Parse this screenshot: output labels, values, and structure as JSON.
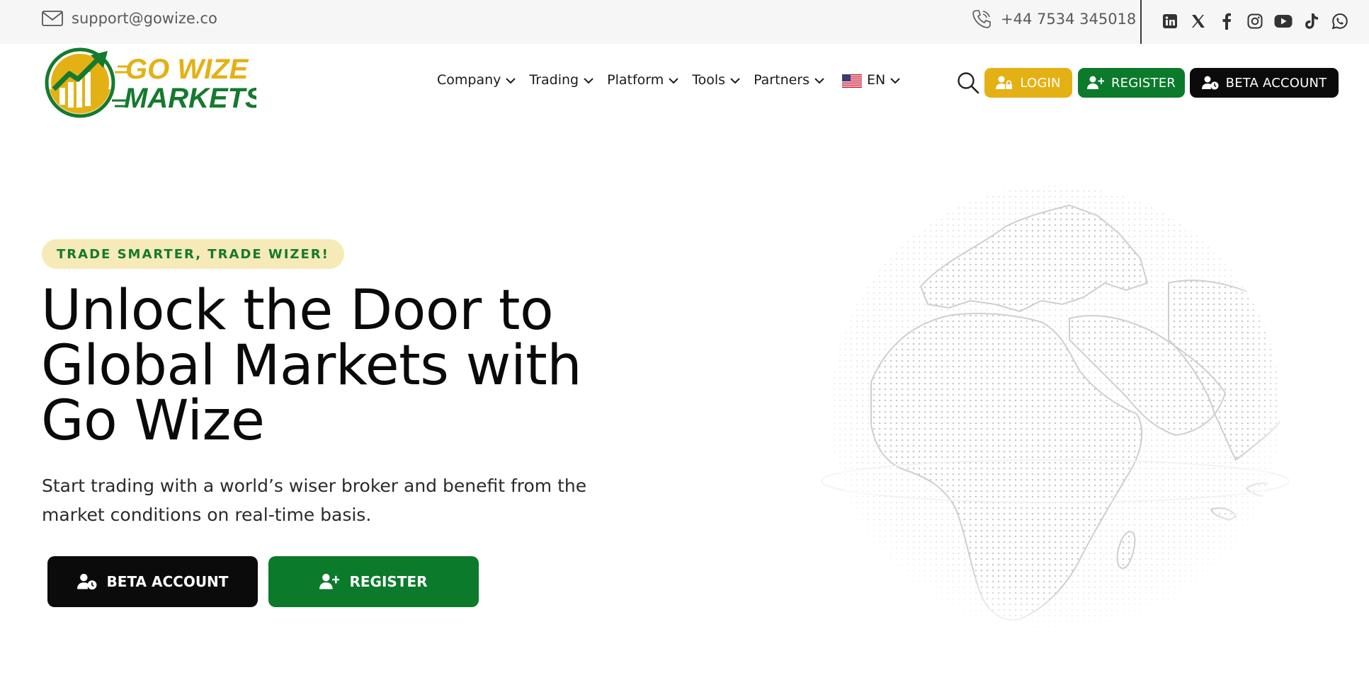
{
  "topbar": {
    "email": "support@gowize.co",
    "phone": "+44 7534 345018",
    "social_icons": [
      "linkedin-icon",
      "x-icon",
      "facebook-icon",
      "instagram-icon",
      "youtube-icon",
      "tiktok-icon",
      "whatsapp-icon"
    ]
  },
  "logo": {
    "line1": "GO WIZE",
    "line2": "MARKETS"
  },
  "nav": {
    "items": [
      {
        "label": "Company"
      },
      {
        "label": "Trading"
      },
      {
        "label": "Platform"
      },
      {
        "label": "Tools"
      },
      {
        "label": "Partners"
      }
    ],
    "language": "EN"
  },
  "header_buttons": {
    "login": "LOGIN",
    "register": "REGISTER",
    "beta": "BETA ACCOUNT"
  },
  "hero": {
    "tagline": "TRADE SMARTER, TRADE WIZER!",
    "title_lines": [
      "Unlock the Door to",
      "Global Markets with",
      "Go Wize"
    ],
    "subtitle": "Start trading with a world’s wiser broker and benefit from the market conditions on real-time basis.",
    "cta_beta": "BETA ACCOUNT",
    "cta_register": "REGISTER"
  },
  "colors": {
    "brand_green": "#0b7a2b",
    "brand_yellow": "#e4b114",
    "black": "#0b0b0b",
    "tagline_bg": "#f6eab8",
    "topbar_bg": "#f6f6f6"
  }
}
